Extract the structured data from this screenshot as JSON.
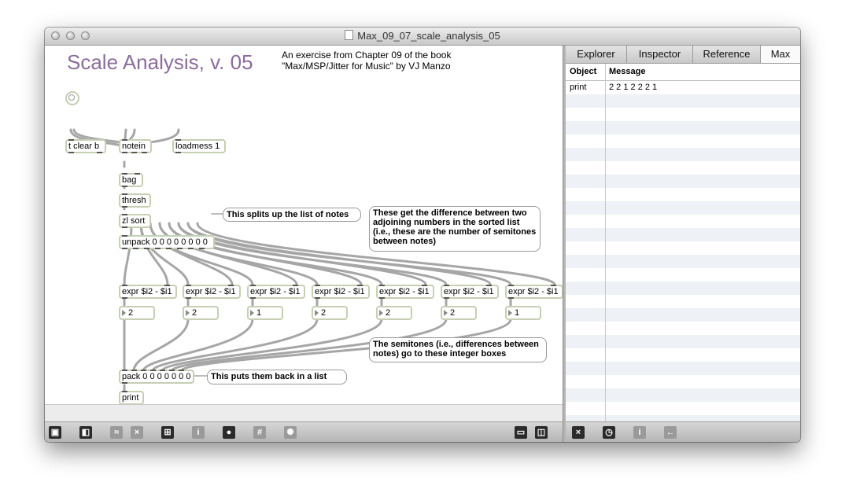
{
  "window": {
    "title": "Max_09_07_scale_analysis_05"
  },
  "patcher": {
    "title": "Scale Analysis, v. 05",
    "header_comment": [
      "An exercise from Chapter 09 of the book",
      "\"Max/MSP/Jitter for Music\" by VJ Manzo"
    ],
    "objects": {
      "t_clear_b": "t clear b",
      "notein": "notein",
      "loadmess": "loadmess 1",
      "bag": "bag",
      "thresh": "thresh",
      "zl_sort": "zl sort",
      "unpack": "unpack 0 0 0 0 0 0 0 0",
      "expr_label": "expr $i2 - $i1",
      "pack": "pack 0 0 0 0 0 0 0",
      "print": "print"
    },
    "number_boxes": [
      2,
      2,
      1,
      2,
      2,
      2,
      1
    ],
    "comments": {
      "unpack_note": "This splits up the list of notes",
      "difference_note": [
        "These get the difference between two",
        "adjoining numbers in the sorted list",
        "(i.e., these are the number of semitones",
        "between notes)"
      ],
      "semitones_note": [
        "The semitones (i.e., differences between",
        "notes) go to these integer boxes"
      ],
      "pack_note": "This puts them back in a list"
    },
    "toolbar_icons": [
      "lock-icon",
      "presentation-icon",
      "patch-cord-icon",
      "clear-icon",
      "new-object-icon",
      "info-icon",
      "inlet-icon",
      "grid-icon",
      "debug-icon",
      "bottom-panel-icon",
      "side-panel-icon"
    ]
  },
  "max_window": {
    "tabs": [
      "Explorer",
      "Inspector",
      "Reference",
      "Max"
    ],
    "active_tab": "Max",
    "columns": [
      "Object",
      "Message"
    ],
    "rows": [
      {
        "object": "print",
        "message": "2 2 1 2 2 2 1"
      }
    ],
    "toolbar_icons": [
      "clear-icon",
      "clock-icon",
      "info-icon",
      "back-arrow-icon"
    ]
  }
}
